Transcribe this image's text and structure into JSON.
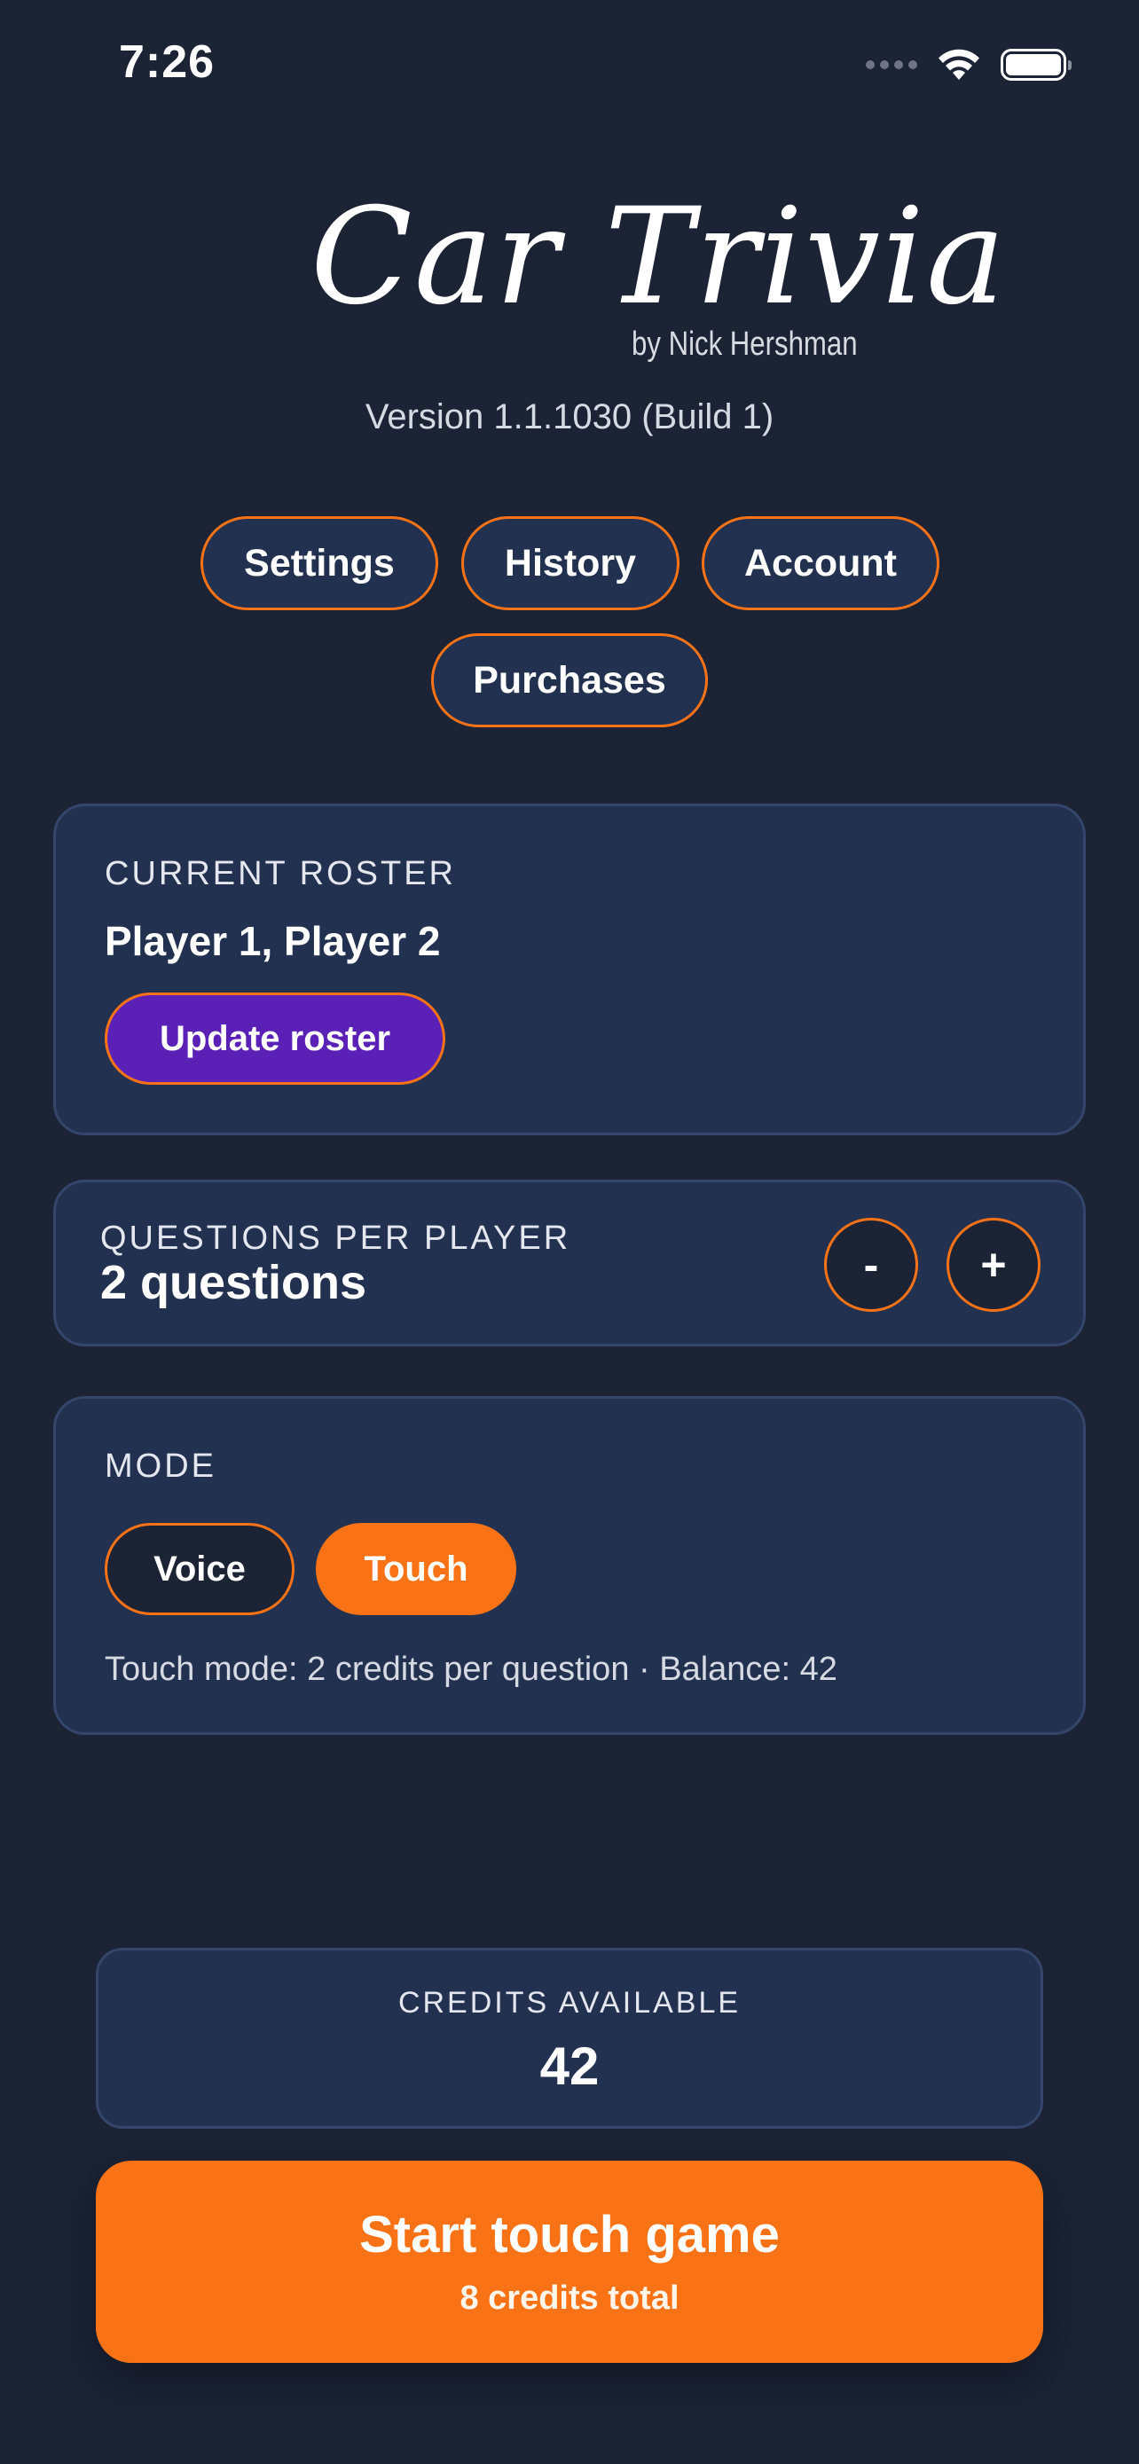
{
  "status_bar": {
    "time": "7:26"
  },
  "header": {
    "logo_title": "Car Trivia",
    "logo_subtitle": "by Nick Hershman",
    "version": "Version 1.1.1030 (Build 1)"
  },
  "nav": {
    "settings": "Settings",
    "history": "History",
    "account": "Account",
    "purchases": "Purchases"
  },
  "roster": {
    "label": "CURRENT ROSTER",
    "players": "Player 1, Player 2",
    "update_label": "Update roster"
  },
  "questions": {
    "label": "QUESTIONS PER PLAYER",
    "value": "2 questions",
    "decrement": "-",
    "increment": "+"
  },
  "mode": {
    "label": "MODE",
    "options": [
      "Voice",
      "Touch"
    ],
    "selected": "Touch",
    "note": "Touch mode: 2 credits per question · Balance: 42"
  },
  "credits": {
    "label": "CREDITS AVAILABLE",
    "value": "42"
  },
  "start": {
    "title": "Start touch game",
    "subtitle": "8 credits total"
  },
  "colors": {
    "background": "#1b2335",
    "card": "#233150",
    "accent": "#f97316",
    "roster_button": "#5b21b6"
  }
}
